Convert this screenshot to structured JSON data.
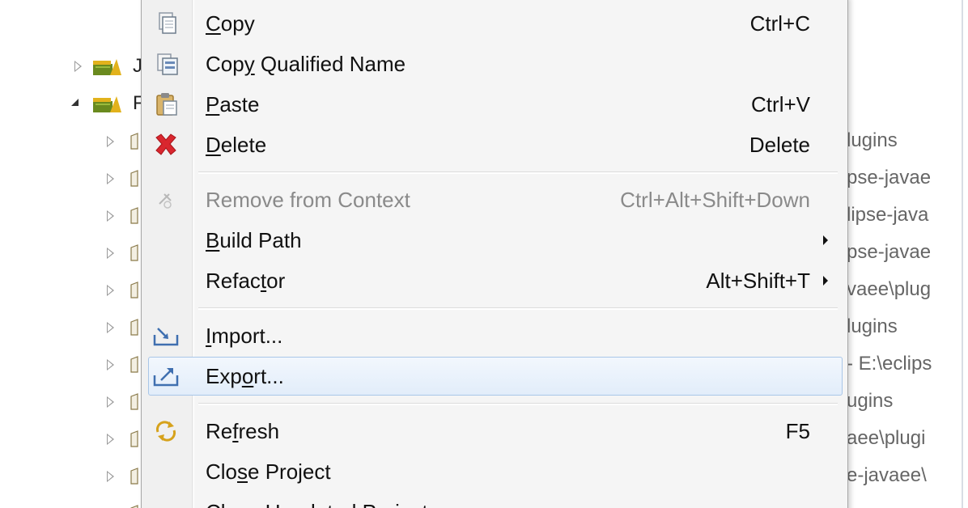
{
  "tree": {
    "top_items": [
      {
        "letter": "J",
        "expanded": false
      },
      {
        "letter": "F",
        "expanded": true
      }
    ],
    "child_paths": [
      "lugins",
      "pse-javae",
      "lipse-java",
      "pse-javae",
      "vaee\\plug",
      "lugins",
      "- E:\\eclips",
      "ugins",
      "aee\\plugi",
      "e-javaee\\",
      ""
    ]
  },
  "menu": {
    "items": [
      {
        "icon": "copy-icon",
        "label": "Copy",
        "mnemonic_index": 0,
        "shortcut": "Ctrl+C",
        "disabled": false
      },
      {
        "icon": "copy-qualified-name-icon",
        "label": "Copy Qualified Name",
        "mnemonic_index": 3,
        "shortcut": "",
        "disabled": false
      },
      {
        "icon": "paste-icon",
        "label": "Paste",
        "mnemonic_index": 0,
        "shortcut": "Ctrl+V",
        "disabled": false
      },
      {
        "icon": "delete-icon",
        "label": "Delete",
        "mnemonic_index": 0,
        "shortcut": "Delete",
        "disabled": false
      },
      {
        "icon": "remove-context-icon",
        "label": "Remove from Context",
        "mnemonic_index": -1,
        "shortcut": "Ctrl+Alt+Shift+Down",
        "disabled": true
      },
      {
        "icon": "",
        "label": "Build Path",
        "mnemonic_index": 0,
        "shortcut": "",
        "submenu": true,
        "disabled": false
      },
      {
        "icon": "",
        "label": "Refactor",
        "mnemonic_index": 5,
        "shortcut": "Alt+Shift+T",
        "submenu": true,
        "disabled": false
      },
      {
        "icon": "import-icon",
        "label": "Import...",
        "mnemonic_index": 0,
        "shortcut": "",
        "disabled": false
      },
      {
        "icon": "export-icon",
        "label": "Export...",
        "mnemonic_index": 3,
        "shortcut": "",
        "disabled": false,
        "hover": true
      },
      {
        "icon": "refresh-icon",
        "label": "Refresh",
        "mnemonic_index": 2,
        "shortcut": "F5",
        "disabled": false
      },
      {
        "icon": "",
        "label": "Close Project",
        "mnemonic_index": 3,
        "shortcut": "",
        "disabled": false
      },
      {
        "icon": "",
        "label": "Close Unrelated Project",
        "mnemonic_index": -1,
        "shortcut": "",
        "disabled": false
      }
    ]
  },
  "colors": {
    "menu_bg": "#f5f5f5",
    "hover_border": "#a9c6e8",
    "delete_red": "#d9262e",
    "project_icon_green": "#6a8a1e",
    "project_icon_yellow": "#e2b21c"
  }
}
